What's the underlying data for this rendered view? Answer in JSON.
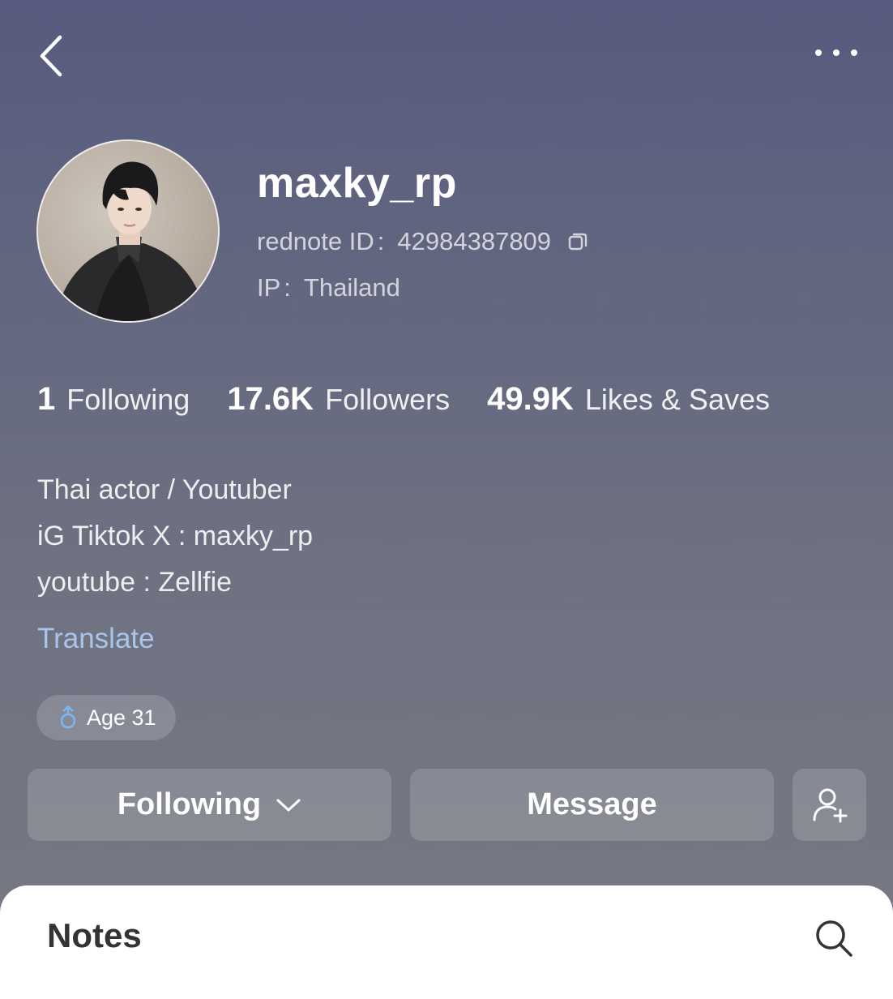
{
  "header": {
    "back_icon": "chevron-left-icon",
    "more_icon": "more-horizontal-icon"
  },
  "profile": {
    "avatar": "avatar-photo",
    "username": "maxky_rp",
    "rednote_label": "rednote ID",
    "rednote_sep": ":",
    "rednote_id": "42984387809",
    "ip_label": "IP",
    "ip_sep": ":",
    "ip_value": "Thailand"
  },
  "stats": {
    "following_count": "1",
    "following_label": "Following",
    "followers_count": "17.6K",
    "followers_label": "Followers",
    "likes_count": "49.9K",
    "likes_label": "Likes & Saves"
  },
  "bio": {
    "lines": [
      "Thai actor / Youtuber",
      "iG Tiktok X : maxky_rp",
      "youtube : Zellfie"
    ],
    "translate_label": "Translate"
  },
  "tags": {
    "age_label": "Age 31",
    "gender_icon": "male-symbol-icon"
  },
  "actions": {
    "following_label": "Following",
    "message_label": "Message",
    "add_friend_icon": "add-user-icon"
  },
  "notes": {
    "title": "Notes",
    "search_icon": "search-icon"
  },
  "colors": {
    "accent_link": "#a9c6ea",
    "gender_icon": "#79b7f5",
    "background_top": "#565b7f",
    "background_bottom": "#777983"
  }
}
